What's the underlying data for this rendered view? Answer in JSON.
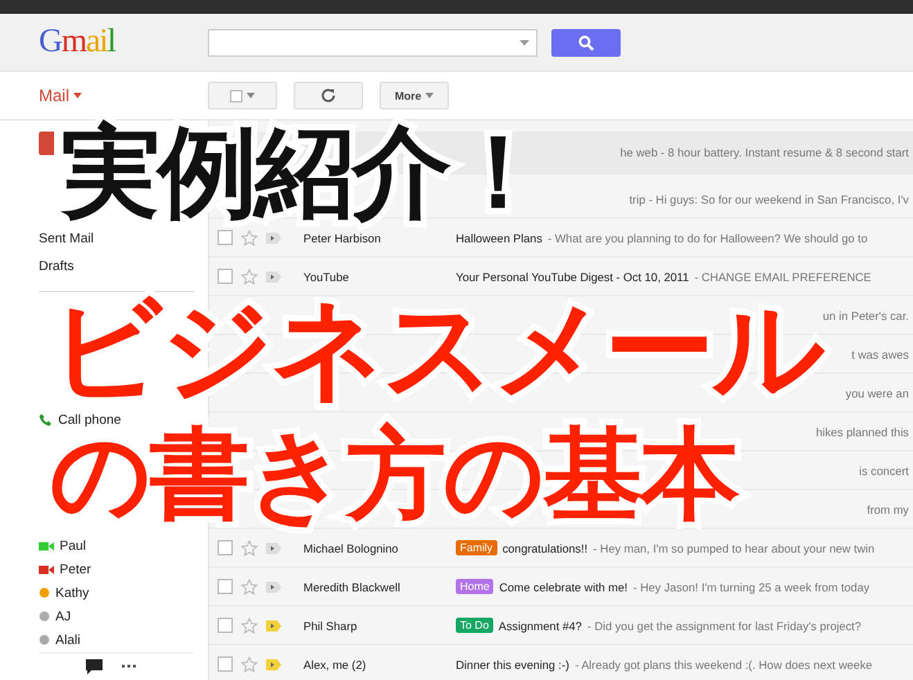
{
  "header": {
    "logo": "Gmail"
  },
  "toolbar": {
    "mail_menu": "Mail",
    "more_button": "More"
  },
  "sidebar": {
    "folders": [
      "Sent Mail",
      "Drafts"
    ],
    "chat_contacts": [
      {
        "name": "Call phone",
        "kind": "phone"
      },
      {
        "name": "Paul",
        "kind": "video"
      },
      {
        "name": "Peter",
        "kind": "busy"
      },
      {
        "name": "Kathy",
        "kind": "idle"
      },
      {
        "name": "AJ",
        "kind": "offline"
      },
      {
        "name": "Alali",
        "kind": "offline"
      }
    ]
  },
  "messages": [
    {
      "snippet": "he web - 8 hour battery. Instant resume & 8 second start",
      "kind": "ad"
    },
    {
      "snippet": "trip - Hi guys: So for our weekend in San Francisco, I'v",
      "kind": "mail"
    },
    {
      "sender": "Peter Harbison",
      "subject": "Halloween Plans",
      "snippet": "- What are you planning to do for Halloween? We should go to",
      "checked": false,
      "important": false,
      "kind": "mail"
    },
    {
      "sender": "YouTube",
      "subject": "Your Personal YouTube Digest - Oct 10, 2011",
      "snippet": "- CHANGE EMAIL PREFERENCE",
      "checked": false,
      "important": false,
      "kind": "mail"
    },
    {
      "snippet": "un in Peter's car.",
      "kind": "mail"
    },
    {
      "snippet": "t was awes",
      "kind": "mail"
    },
    {
      "snippet": "you were an",
      "kind": "mail"
    },
    {
      "snippet": "hikes planned this",
      "kind": "mail"
    },
    {
      "snippet": "is concert",
      "kind": "mail"
    },
    {
      "snippet": "from my",
      "kind": "mail"
    },
    {
      "sender": "Michael Bolognino",
      "labels": [
        {
          "text": "Family",
          "color": "#e66b00"
        }
      ],
      "subject": "congratulations!!",
      "snippet": "- Hey man, I'm so pumped to hear about your new twin",
      "checked": false,
      "important": false,
      "kind": "mail"
    },
    {
      "sender": "Meredith Blackwell",
      "labels": [
        {
          "text": "Home",
          "color": "#b373e8"
        }
      ],
      "subject": "Come celebrate with me!",
      "snippet": "- Hey Jason! I'm turning 25 a week from today",
      "checked": false,
      "important": false,
      "kind": "mail"
    },
    {
      "sender": "Phil Sharp",
      "labels": [
        {
          "text": "To Do",
          "color": "#16a765"
        }
      ],
      "subject": "Assignment #4?",
      "snippet": "- Did you get the assignment for last Friday's project?",
      "checked": false,
      "important": true,
      "kind": "mail"
    },
    {
      "sender": "Alex, me (2)",
      "subject": "Dinner this evening :-)",
      "snippet": "- Already got plans this weekend :(. How does next weeke",
      "checked": false,
      "important": true,
      "kind": "mail"
    }
  ],
  "overlay": {
    "title": "実例紹介！",
    "lines": [
      "ビジネスメール",
      "の書き方の基本"
    ]
  }
}
